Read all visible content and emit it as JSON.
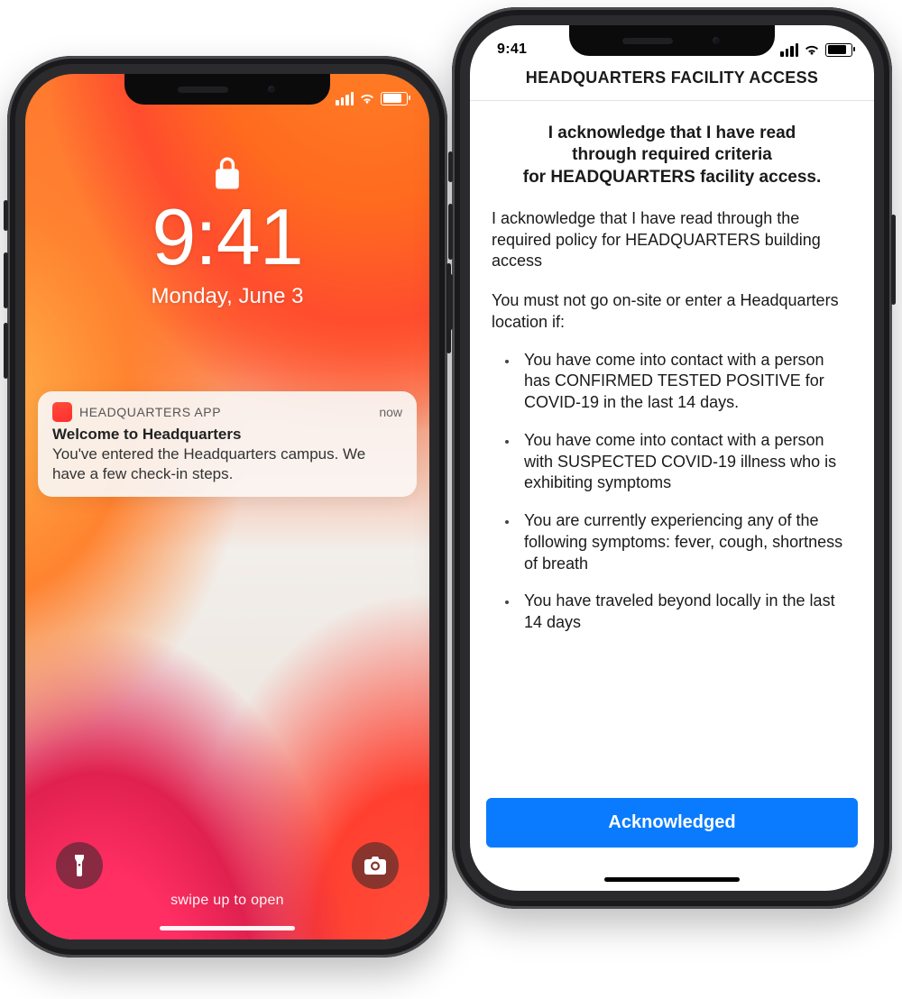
{
  "status": {
    "time": "9:41"
  },
  "lockscreen": {
    "time": "9:41",
    "date": "Monday, June 3",
    "swipe_hint": "swipe up to open"
  },
  "notification": {
    "app_name": "HEADQUARTERS APP",
    "time_label": "now",
    "title": "Welcome to Headquarters",
    "body": "You've entered the Headquarters campus. We have a few check-in steps."
  },
  "access_page": {
    "header": "HEADQUARTERS FACILITY ACCESS",
    "heading_line1": "I acknowledge that I have read",
    "heading_line2": "through required criteria",
    "heading_line3": "for HEADQUARTERS facility access.",
    "paragraph": "I acknowledge that I have read through the required policy for HEADQUARTERS building access",
    "lead": "You must not go on-site or enter a Headquarters location if:",
    "bullets": [
      "You have come into contact with a person has CONFIRMED TESTED POSITIVE for COVID-19 in the last 14 days.",
      "You have come into contact with a person with SUSPECTED COVID-19 illness who is exhibiting symptoms",
      "You are currently experiencing any of the following symptoms: fever, cough, shortness of breath",
      "You have traveled beyond locally in the last 14 days"
    ],
    "button": "Acknowledged"
  },
  "colors": {
    "accent_button": "#0a7bff",
    "notif_app_icon": "#ff3b30"
  }
}
